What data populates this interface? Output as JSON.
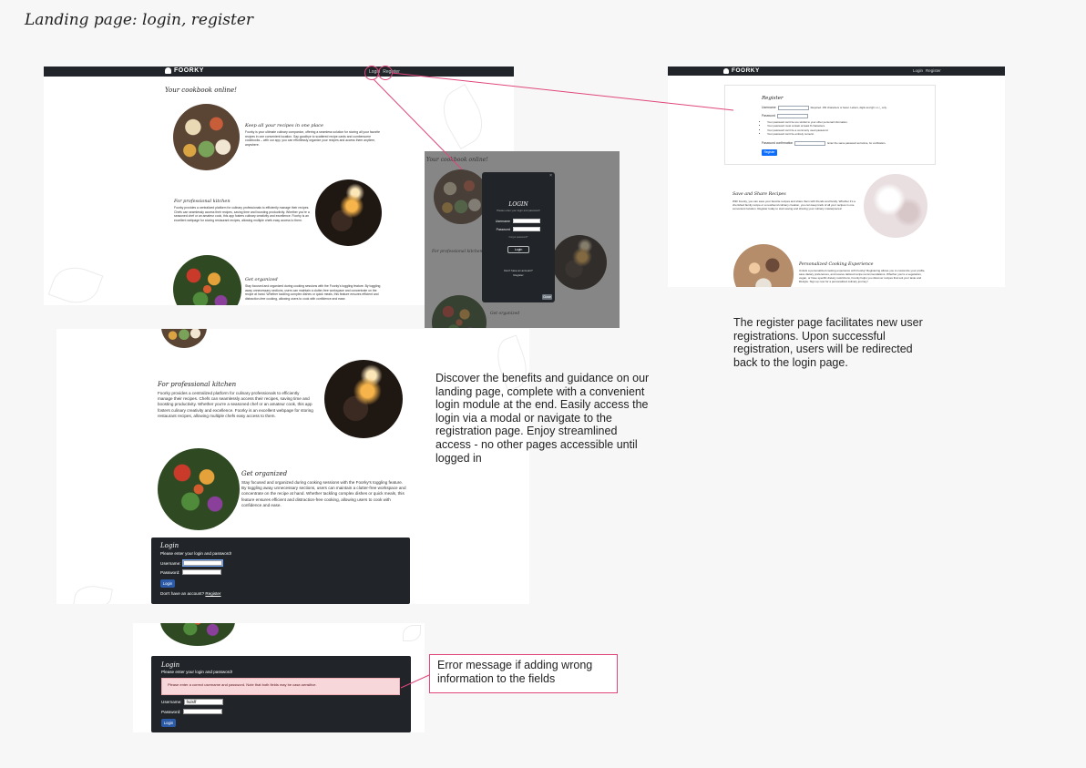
{
  "board": {
    "title": "Landing page: login, register"
  },
  "app": {
    "brand": "FOORKY",
    "nav": {
      "login": "Login",
      "register": "Register"
    }
  },
  "landing": {
    "headline": "Your cookbook online!",
    "features": [
      {
        "title": "Keep all your recipes in one place",
        "body": "Foorky is your ultimate culinary companion, offering a seamless solution for storing all your favorite recipes in one convenient location. Say goodbye to scattered recipe cards and cumbersome cookbooks – with our app, you can effortlessly organize your recipes and access them anytime, anywhere."
      },
      {
        "title": "For professional kitchen",
        "body": "Foorky provides a centralized platform for culinary professionals to efficiently manage their recipes. Chefs can seamlessly access their recipes, saving time and boosting productivity. Whether you're a seasoned chef or an amateur cook, this app fosters culinary creativity and excellence. Foorky is an excellent webpage for storing restaurant recipes, allowing multiple chefs easy access to them."
      },
      {
        "title": "Get organized",
        "body": "Stay focused and organized during cooking sessions with the Foorky's toggling feature. By toggling away unnecessary sections, users can maintain a clutter-free workspace and concentrate on the recipe at hand. Whether tackling complex dishes or quick meals, this feature ensures efficient and distraction-free cooking, allowing users to cook with confidence and ease."
      }
    ]
  },
  "modal": {
    "title": "LOGIN",
    "subtitle": "Please enter your login and password!",
    "username_label": "Username",
    "password_label": "Password",
    "forgot": "Forgot password?",
    "login_button": "Login",
    "no_account": "Don't have an account?",
    "register_link": "Register",
    "close_button": "Close",
    "close_icon": "×"
  },
  "register": {
    "title": "Register",
    "username_label": "Username",
    "username_help": "Required. 150 characters or fewer. Letters, digits and @/./+/-/_ only.",
    "password_label": "Password",
    "rules": [
      "Your password can't be too similar to your other personal information.",
      "Your password must contain at least 8 characters.",
      "Your password can't be a commonly used password.",
      "Your password can't be entirely numeric."
    ],
    "confirm_label": "Password confirmation",
    "confirm_help": "Enter the same password as before, for verification.",
    "submit": "Register",
    "features": [
      {
        "title": "Save and Share Recipes",
        "body": "With Foorky, you can save your favorite recipes and share them with friends and family. Whether it's a cherished family recipe or a newfound culinary creation, you can keep track of all your recipes in one convenient location. Register today to start saving and sharing your culinary masterpieces!"
      },
      {
        "title": "Personalized Cooking Experience",
        "body": "Unlock a personalized cooking experience with Foorky! Registering allows you to customize your profile, save dietary preferences, and receive tailored recipe recommendations. Whether you're a vegetarian, vegan, or have specific dietary restrictions, Foorky helps you discover recipes that suit your taste and lifestyle. Sign up now for a personalized culinary journey!"
      }
    ]
  },
  "login_section": {
    "title": "Login",
    "prompt": "Please enter your login and password!",
    "username_label": "Username:",
    "password_label": "Password:",
    "login_button": "Login",
    "no_account": "Don't have an account?",
    "register_link": "Register"
  },
  "error_section": {
    "title": "Login",
    "prompt": "Please enter your login and password!",
    "error": "Please enter a correct username and password. Note that both fields may be case-sensitive.",
    "username_label": "Username:",
    "username_value": "fsdsff",
    "password_label": "Password:",
    "login_button": "Login"
  },
  "captions": {
    "register": "The register page facilitates new user registrations. Upon successful registration, users will be redirected back to the login page.",
    "landing": "Discover the benefits and guidance on our landing page, complete with a convenient login module at the end. Easily access the login via a modal or navigate to the registration page. Enjoy streamlined access - no other pages accessible until logged in",
    "error": "Error message if adding wrong information to the fields"
  },
  "colors": {
    "navbar": "#212529",
    "annotation": "#e0467c",
    "primary": "#2b5aa8",
    "error_bg": "#f8d7da"
  },
  "icons": {
    "brand": "chef-hat-icon",
    "close": "close-icon"
  }
}
